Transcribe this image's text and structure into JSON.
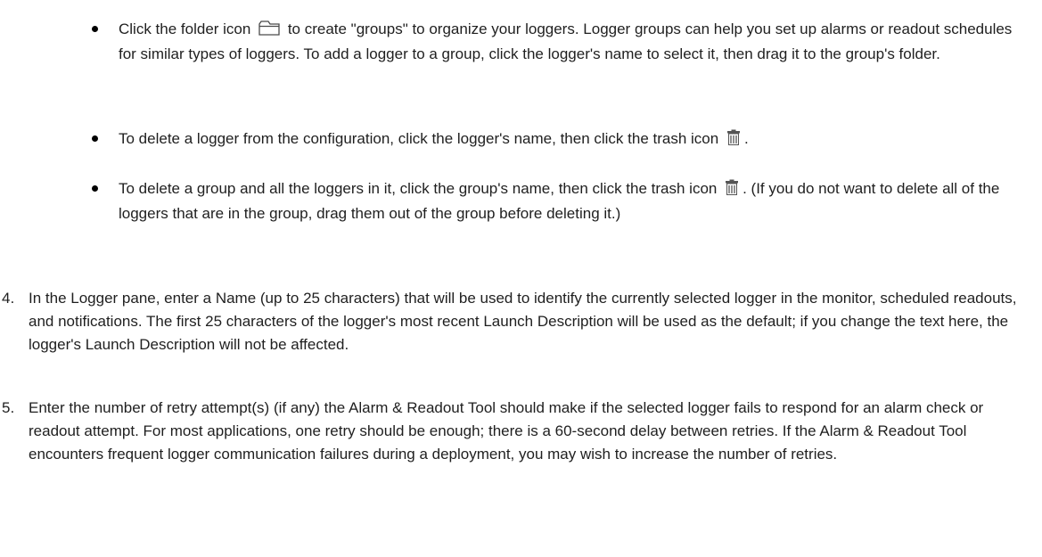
{
  "bullets": [
    {
      "text_before_icon": "Click the folder icon",
      "icon": "folder-icon",
      "text_after_icon": "to create \"groups\" to organize your loggers. Logger groups can help you set up alarms or readout schedules for similar types of loggers. To add a logger to a group, click the logger's name to select it, then drag it to the group's folder."
    },
    {
      "text_before_icon": "To delete a logger from the configuration, click the logger's name, then click the trash icon",
      "icon": "trash-icon",
      "text_after_icon": "."
    },
    {
      "text_before_icon": "To delete a group and all the loggers in it, click the group's name, then click the trash icon",
      "icon": "trash-icon",
      "text_after_icon": ". (If you do not want to delete all of the loggers that are in the group, drag them out of the group before deleting it.)"
    }
  ],
  "steps": [
    {
      "number": "4.",
      "text": "In the Logger pane, enter a Name (up to 25 characters) that will be used to identify the currently selected logger in the monitor, scheduled readouts, and notifications. The first 25 characters of the logger's most recent Launch Description will be used as the default; if you change the text here, the logger's Launch Description will not be affected."
    },
    {
      "number": "5.",
      "text": "Enter the number of retry attempt(s) (if any) the Alarm & Readout Tool should make if the selected logger fails to respond for an alarm check or readout attempt. For most applications, one retry should be enough; there is a 60-second delay between retries. If the Alarm & Readout Tool encounters frequent logger communication failures during a deployment, you may wish to increase the number of retries."
    }
  ]
}
